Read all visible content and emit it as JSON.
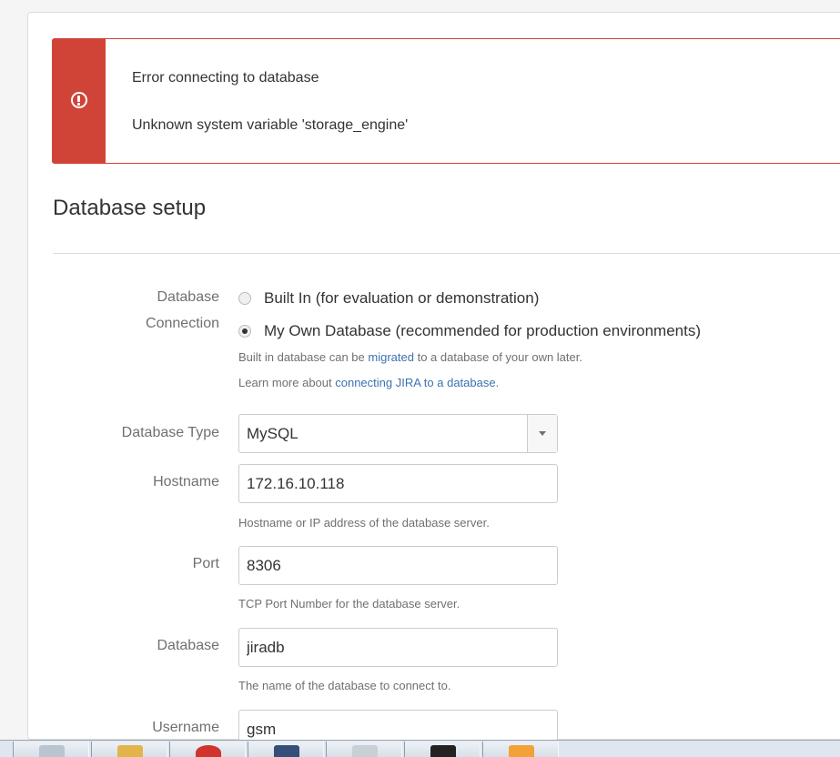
{
  "error": {
    "icon": "exclamation-circle-icon",
    "title": "Error connecting to database",
    "message": "Unknown system variable 'storage_engine'"
  },
  "page": {
    "title": "Database setup"
  },
  "connection": {
    "label_line1": "Database",
    "label_line2": "Connection",
    "options": [
      {
        "label": "Built In (for evaluation or demonstration)",
        "checked": false
      },
      {
        "label": "My Own Database (recommended for production environments)",
        "checked": true
      }
    ],
    "help1_prefix": "Built in database can be ",
    "help1_link": "migrated",
    "help1_suffix": " to a database of your own later.",
    "help2_prefix": "Learn more about ",
    "help2_link": "connecting JIRA to a database",
    "help2_suffix": "."
  },
  "database_type": {
    "label": "Database Type",
    "value": "MySQL"
  },
  "hostname": {
    "label": "Hostname",
    "value": "172.16.10.118",
    "help": "Hostname or IP address of the database server."
  },
  "port": {
    "label": "Port",
    "value": "8306",
    "help": "TCP Port Number for the database server."
  },
  "database": {
    "label": "Database",
    "value": "jiradb",
    "help": "The name of the database to connect to."
  },
  "username": {
    "label": "Username",
    "value": "gsm"
  },
  "taskbar": {
    "items": [
      {
        "icon": "window-icon",
        "color": "#b9c4d1"
      },
      {
        "icon": "folder-icon",
        "color": "#e2b54a"
      },
      {
        "icon": "browser-icon",
        "color": "#d0342c"
      },
      {
        "icon": "tools-icon",
        "color": "#34507a"
      },
      {
        "icon": "document-icon",
        "color": "#c9cfd6"
      },
      {
        "icon": "terminal-icon",
        "color": "#222222"
      },
      {
        "icon": "script-icon",
        "color": "#f2a236"
      }
    ]
  }
}
